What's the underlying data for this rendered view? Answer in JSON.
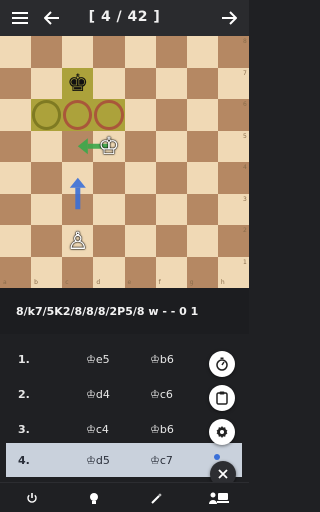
{
  "header": {
    "counter": "[ 4 / 42 ]",
    "icons": {
      "menu": "hamburger-menu-icon",
      "back": "arrow-left-icon",
      "forward": "arrow-right-icon"
    }
  },
  "board": {
    "files": [
      "a",
      "b",
      "c",
      "d",
      "e",
      "f",
      "g",
      "h"
    ],
    "ranks": [
      "8",
      "7",
      "6",
      "5",
      "4",
      "3",
      "2",
      "1"
    ],
    "pieces": [
      {
        "name": "black-king",
        "glyph": "♚",
        "square": "c7"
      },
      {
        "name": "white-king",
        "glyph": "♔",
        "square": "d5"
      },
      {
        "name": "white-pawn",
        "glyph": "♙",
        "square": "c2"
      }
    ],
    "highlighted_squares": [
      "b6",
      "c6",
      "d6"
    ],
    "arrows": [
      {
        "color": "#3a6fd8",
        "from": "c3",
        "to": "c4"
      },
      {
        "color": "#3aa84a",
        "from": "d5",
        "to": "c5"
      }
    ]
  },
  "fen": "8/k7/5K2/8/8/8/2P5/8 w - - 0 1",
  "moves": [
    {
      "num": "1.",
      "white": "♔e5",
      "black": "♔b6"
    },
    {
      "num": "2.",
      "white": "♔d4",
      "black": "♔c6"
    },
    {
      "num": "3.",
      "white": "♔c4",
      "black": "♔b6"
    },
    {
      "num": "4.",
      "white": "♔d5",
      "black": "♔c7"
    }
  ],
  "actions": {
    "timer_icon": "timer-icon",
    "clipboard_icon": "clipboard-icon",
    "settings_icon": "gear-icon",
    "close_icon": "close-icon"
  },
  "bottom_nav": {
    "icons": [
      "power-icon",
      "lightbulb-icon",
      "magic-wand-icon",
      "user-computer-icon"
    ]
  }
}
